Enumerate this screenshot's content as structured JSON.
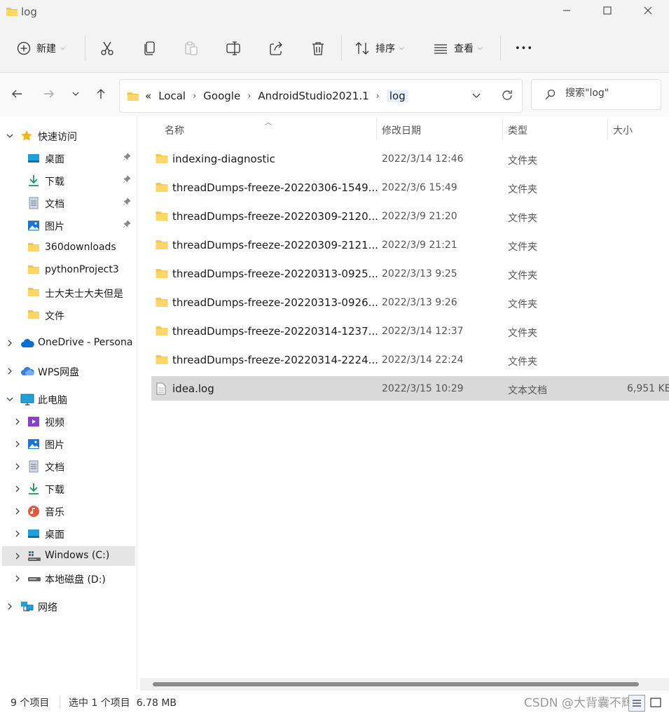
{
  "window": {
    "title": "log"
  },
  "toolbar": {
    "new_label": "新建",
    "sort_label": "排序",
    "view_label": "查看",
    "more_label": "•••"
  },
  "address": {
    "crumbs_prefix": "«",
    "crumbs": [
      "Local",
      "Google",
      "AndroidStudio2021.1",
      "log"
    ]
  },
  "search": {
    "placeholder": "搜索\"log\""
  },
  "sidebar": {
    "quick_access": "快速访问",
    "quick_items": [
      {
        "label": "桌面",
        "icon": "desktop-icon",
        "pinned": true
      },
      {
        "label": "下载",
        "icon": "download-icon",
        "pinned": true
      },
      {
        "label": "文档",
        "icon": "document-icon",
        "pinned": true
      },
      {
        "label": "图片",
        "icon": "pictures-icon",
        "pinned": true
      },
      {
        "label": "360downloads",
        "icon": "folder-icon",
        "pinned": false
      },
      {
        "label": "pythonProject3",
        "icon": "folder-icon",
        "pinned": false
      },
      {
        "label": "士大夫士大夫但是",
        "icon": "folder-icon",
        "pinned": false
      },
      {
        "label": "文件",
        "icon": "folder-icon",
        "pinned": false
      }
    ],
    "onedrive": "OneDrive - Persona",
    "wps": "WPS网盘",
    "this_pc": "此电脑",
    "pc_items": [
      {
        "label": "视频",
        "icon": "video-icon"
      },
      {
        "label": "图片",
        "icon": "pictures-icon"
      },
      {
        "label": "文档",
        "icon": "document-icon"
      },
      {
        "label": "下载",
        "icon": "download-icon"
      },
      {
        "label": "音乐",
        "icon": "music-icon"
      },
      {
        "label": "桌面",
        "icon": "desktop-icon"
      },
      {
        "label": "Windows (C:)",
        "icon": "windows-drive-icon",
        "selected": true
      },
      {
        "label": "本地磁盘 (D:)",
        "icon": "drive-icon"
      }
    ],
    "network": "网络"
  },
  "columns": {
    "name": "名称",
    "modified": "修改日期",
    "type": "类型",
    "size": "大小"
  },
  "files": [
    {
      "name": "indexing-diagnostic",
      "modified": "2022/3/14 12:46",
      "type": "文件夹",
      "size": "",
      "kind": "folder"
    },
    {
      "name": "threadDumps-freeze-20220306-1549...",
      "modified": "2022/3/6 15:49",
      "type": "文件夹",
      "size": "",
      "kind": "folder"
    },
    {
      "name": "threadDumps-freeze-20220309-2120...",
      "modified": "2022/3/9 21:20",
      "type": "文件夹",
      "size": "",
      "kind": "folder"
    },
    {
      "name": "threadDumps-freeze-20220309-2121...",
      "modified": "2022/3/9 21:21",
      "type": "文件夹",
      "size": "",
      "kind": "folder"
    },
    {
      "name": "threadDumps-freeze-20220313-0925...",
      "modified": "2022/3/13 9:25",
      "type": "文件夹",
      "size": "",
      "kind": "folder"
    },
    {
      "name": "threadDumps-freeze-20220313-0926...",
      "modified": "2022/3/13 9:26",
      "type": "文件夹",
      "size": "",
      "kind": "folder"
    },
    {
      "name": "threadDumps-freeze-20220314-1237...",
      "modified": "2022/3/14 12:37",
      "type": "文件夹",
      "size": "",
      "kind": "folder"
    },
    {
      "name": "threadDumps-freeze-20220314-2224...",
      "modified": "2022/3/14 22:24",
      "type": "文件夹",
      "size": "",
      "kind": "folder"
    },
    {
      "name": "idea.log",
      "modified": "2022/3/15 10:29",
      "type": "文本文档",
      "size": "6,951 KB",
      "kind": "file",
      "selected": true
    }
  ],
  "status": {
    "count": "9 个项目",
    "selection": "选中 1 个项目  6.78 MB",
    "watermark": "CSDN @大背囊不辉煌"
  },
  "colors": {
    "folder": "#f4c542",
    "accent": "#0067c0",
    "selected_row": "#d9d9d9"
  }
}
